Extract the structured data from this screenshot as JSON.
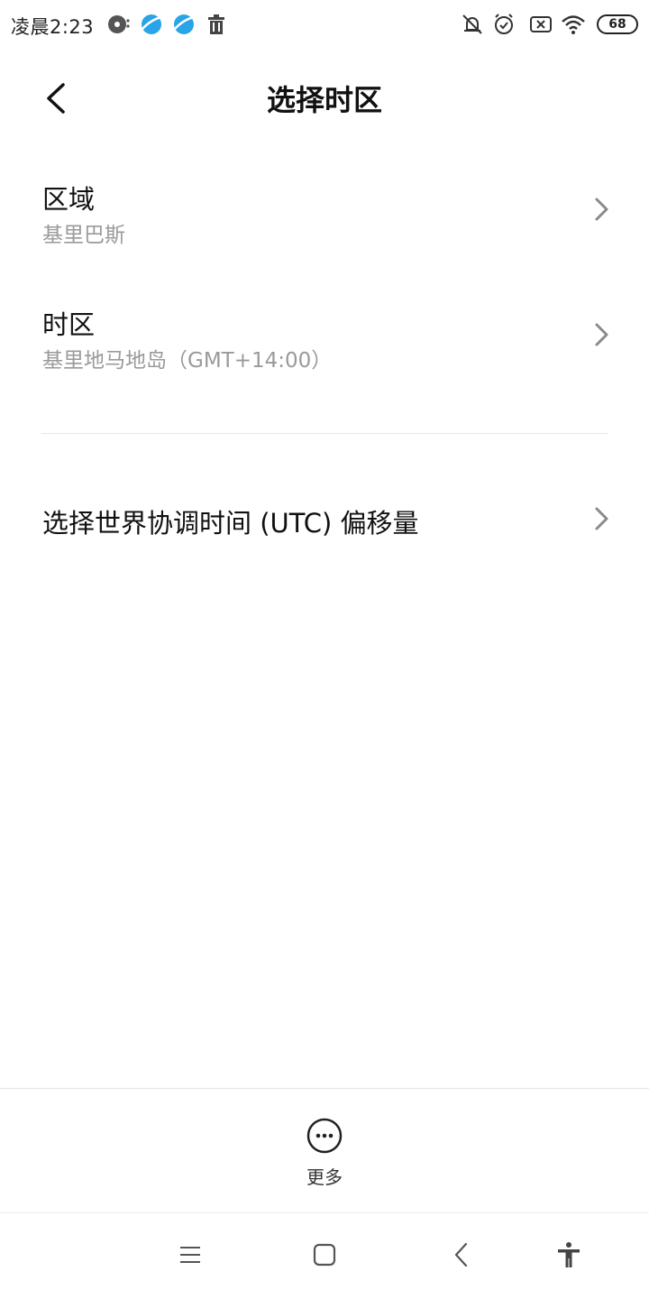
{
  "status_bar": {
    "time": "凌晨2:23",
    "battery": "68",
    "icons": [
      "media-disc-icon",
      "browser-icon",
      "browser-icon",
      "trash-icon",
      "mute-icon",
      "alarm-icon",
      "sim-none-icon",
      "wifi-icon",
      "battery-icon"
    ]
  },
  "header": {
    "title": "选择时区",
    "back_icon": "chevron-left-icon"
  },
  "settings": {
    "region": {
      "title": "区域",
      "value": "基里巴斯"
    },
    "timezone": {
      "title": "时区",
      "value": "基里地马地岛（GMT+14:00）"
    },
    "utc_offset": {
      "title": "选择世界协调时间 (UTC) 偏移量"
    }
  },
  "toolbar": {
    "more_label": "更多",
    "more_icon": "more-dots-icon"
  },
  "navbar": {
    "icons": [
      "menu-icon",
      "home-icon",
      "back-icon",
      "accessibility-icon"
    ]
  },
  "colors": {
    "background": "#ffffff",
    "primary_text": "#111111",
    "secondary_text": "#9a9a9a",
    "chevron": "#8a8a8a"
  }
}
